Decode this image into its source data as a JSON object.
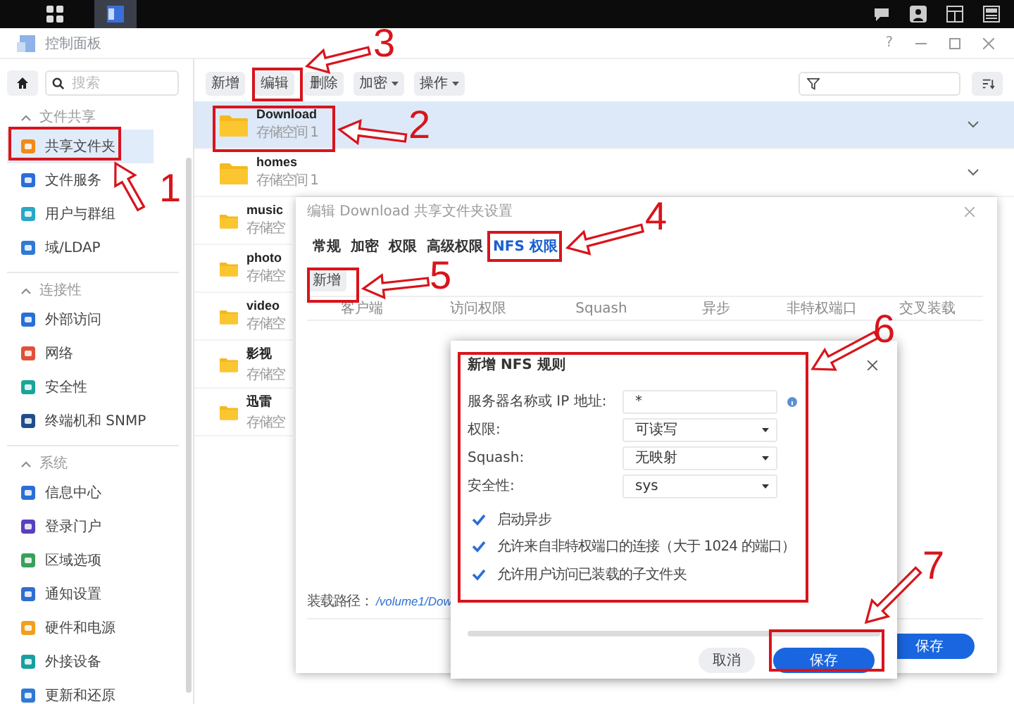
{
  "window": {
    "title": "控制面板",
    "help": "?"
  },
  "sidebar": {
    "search": {
      "placeholder": "搜索"
    },
    "sections": [
      {
        "title": "文件共享",
        "expanded": true,
        "items": [
          {
            "label": "共享文件夹",
            "selected": true
          },
          {
            "label": "文件服务",
            "selected": false
          },
          {
            "label": "用户与群组",
            "selected": false
          },
          {
            "label": "域/LDAP",
            "selected": false
          }
        ]
      },
      {
        "title": "连接性",
        "expanded": true,
        "items": [
          {
            "label": "外部访问",
            "selected": false
          },
          {
            "label": "网络",
            "selected": false
          },
          {
            "label": "安全性",
            "selected": false
          },
          {
            "label": "终端机和 SNMP",
            "selected": false
          }
        ]
      },
      {
        "title": "系统",
        "expanded": true,
        "items": [
          {
            "label": "信息中心",
            "selected": false
          },
          {
            "label": "登录门户",
            "selected": false
          },
          {
            "label": "区域选项",
            "selected": false
          },
          {
            "label": "通知设置",
            "selected": false
          },
          {
            "label": "硬件和电源",
            "selected": false
          },
          {
            "label": "外接设备",
            "selected": false
          },
          {
            "label": "更新和还原",
            "selected": false
          }
        ]
      }
    ]
  },
  "toolbar": [
    {
      "label": "新增",
      "kind": "plain"
    },
    {
      "label": "编辑",
      "kind": "plain"
    },
    {
      "label": "删除",
      "kind": "plain"
    },
    {
      "label": "加密",
      "kind": "dropdown"
    },
    {
      "label": "操作",
      "kind": "dropdown"
    }
  ],
  "folders": [
    {
      "name": "Download",
      "location": "存储空间 1",
      "selected": true
    },
    {
      "name": "homes",
      "location": "存储空间 1",
      "selected": false
    },
    {
      "name": "music",
      "location": "存储空",
      "selected": false
    },
    {
      "name": "photo",
      "location": "存储空",
      "selected": false
    },
    {
      "name": "video",
      "location": "存储空",
      "selected": false
    },
    {
      "name": "影视",
      "location": "存储空",
      "selected": false
    },
    {
      "name": "迅雷",
      "location": "存储空",
      "selected": false
    }
  ],
  "edit_dialog": {
    "title": "编辑 Download 共享文件夹设置",
    "tabs": [
      {
        "label": "常规",
        "selected": false
      },
      {
        "label": "加密",
        "selected": false
      },
      {
        "label": "权限",
        "selected": false
      },
      {
        "label": "高级权限",
        "selected": false
      },
      {
        "label": "NFS 权限",
        "selected": true
      }
    ],
    "add_button": "新增",
    "columns": [
      "客户端",
      "访问权限",
      "Squash",
      "异步",
      "非特权端口",
      "交叉装载"
    ],
    "mount_path_label": "装载路径：",
    "mount_path": "/volume1/Dow",
    "save_button": "保存"
  },
  "rule_dialog": {
    "title": "新增 NFS 规则",
    "fields": [
      {
        "label": "服务器名称或 IP 地址:",
        "value": "*",
        "kind": "text"
      },
      {
        "label": "权限:",
        "value": "可读写",
        "kind": "select"
      },
      {
        "label": "Squash:",
        "value": "无映射",
        "kind": "select"
      },
      {
        "label": "安全性:",
        "value": "sys",
        "kind": "select"
      }
    ],
    "checkboxes": [
      {
        "label": "启动异步",
        "checked": true
      },
      {
        "label": "允许来自非特权端口的连接（大于 1024 的端口）",
        "checked": true
      },
      {
        "label": "允许用户访问已装载的子文件夹",
        "checked": true
      }
    ],
    "buttons": [
      {
        "label": "取消",
        "kind": "secondary"
      },
      {
        "label": "保存",
        "kind": "primary"
      }
    ]
  },
  "annotations": [
    {
      "number": "1"
    },
    {
      "number": "2"
    },
    {
      "number": "3"
    },
    {
      "number": "4"
    },
    {
      "number": "5"
    },
    {
      "number": "6"
    },
    {
      "number": "7"
    }
  ]
}
